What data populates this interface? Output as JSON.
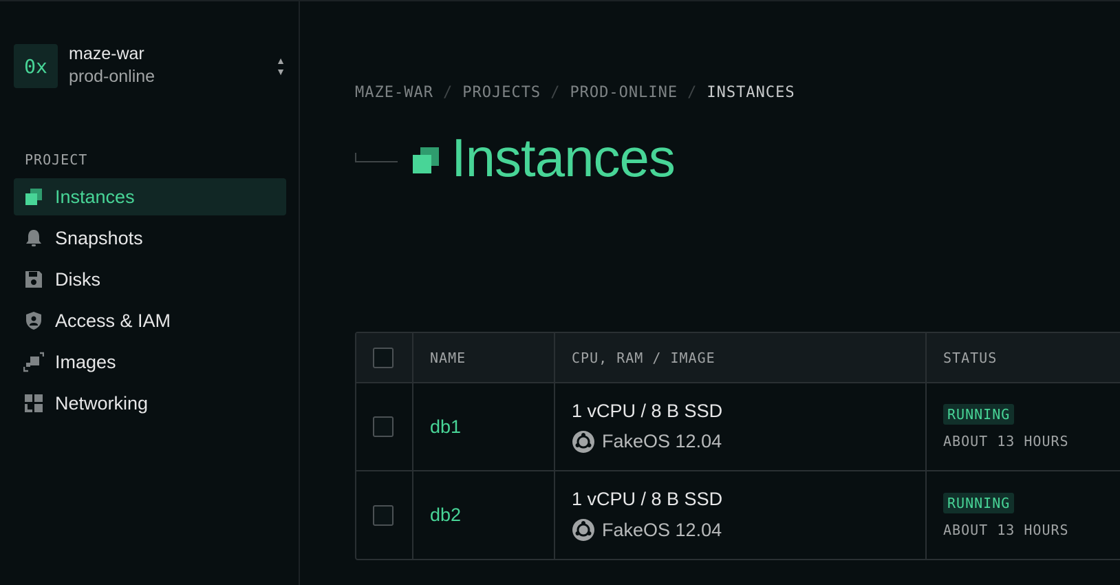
{
  "switcher": {
    "logo_text": "0x",
    "org": "maze-war",
    "project": "prod-online",
    "toggle_up": "▲",
    "toggle_down": "▼"
  },
  "sidebar": {
    "heading": "PROJECT",
    "items": [
      {
        "label": "Instances",
        "icon": "instances-icon",
        "active": true
      },
      {
        "label": "Snapshots",
        "icon": "bell-icon",
        "active": false
      },
      {
        "label": "Disks",
        "icon": "disk-icon",
        "active": false
      },
      {
        "label": "Access & IAM",
        "icon": "shield-icon",
        "active": false
      },
      {
        "label": "Images",
        "icon": "images-icon",
        "active": false
      },
      {
        "label": "Networking",
        "icon": "networking-icon",
        "active": false
      }
    ]
  },
  "breadcrumb": {
    "items": [
      "MAZE-WAR",
      "PROJECTS",
      "PROD-ONLINE",
      "INSTANCES"
    ],
    "separator": "/"
  },
  "page": {
    "title": "Instances"
  },
  "table": {
    "columns": [
      "NAME",
      "CPU, RAM / IMAGE",
      "STATUS"
    ],
    "rows": [
      {
        "name": "db1",
        "spec": "1 vCPU / 8 B SSD",
        "image": "FakeOS 12.04",
        "status": "RUNNING",
        "time": "ABOUT 13 HOURS"
      },
      {
        "name": "db2",
        "spec": "1 vCPU / 8 B SSD",
        "image": "FakeOS 12.04",
        "status": "RUNNING",
        "time": "ABOUT 13 HOURS"
      }
    ]
  },
  "colors": {
    "accent": "#48d597",
    "background": "#080f11",
    "active_bg": "#112725",
    "border": "#2a3033"
  }
}
